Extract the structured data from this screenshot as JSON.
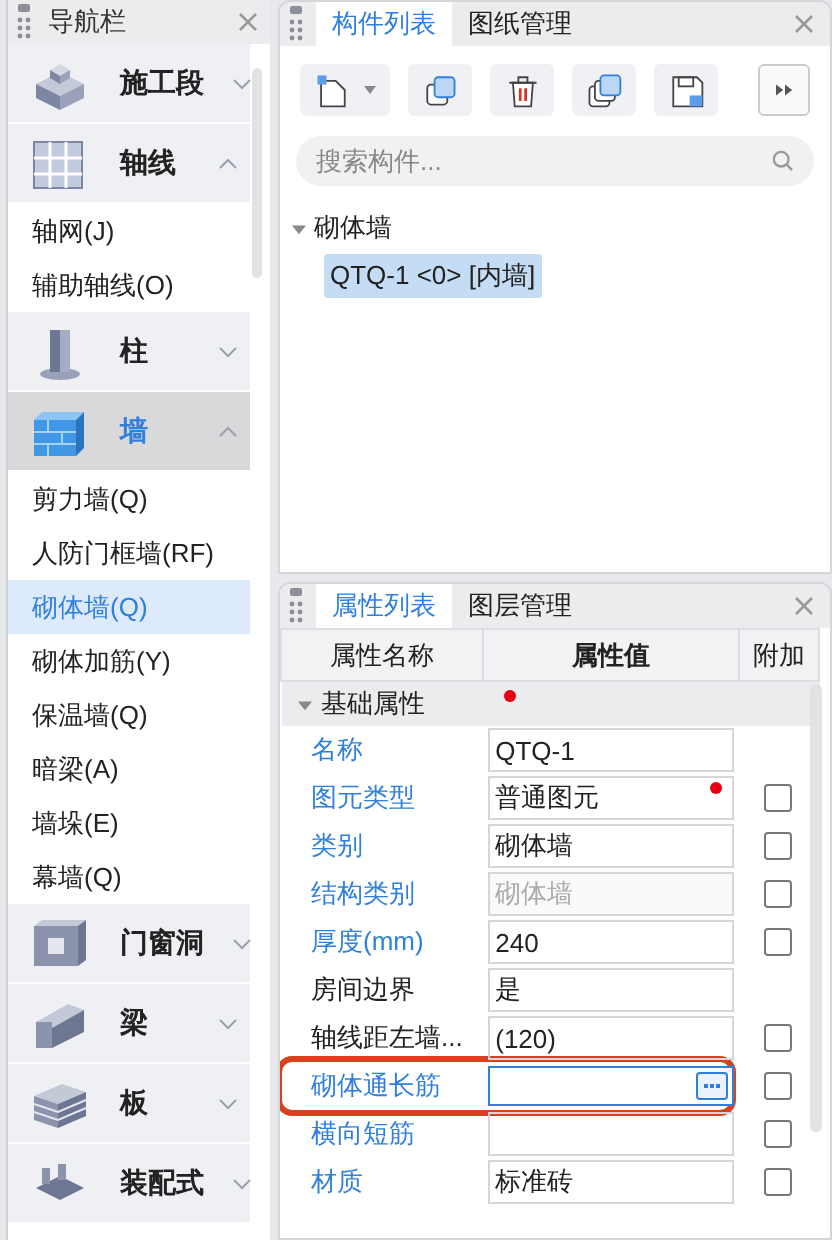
{
  "nav": {
    "title": "导航栏",
    "groups": [
      {
        "label": "施工段",
        "kind": "block",
        "expanded": false,
        "selected": false
      },
      {
        "label": "轴线",
        "kind": "grid",
        "expanded": true,
        "selected": false,
        "items": [
          {
            "label": "轴网(J)",
            "selected": false
          },
          {
            "label": "辅助轴线(O)",
            "selected": false
          }
        ]
      },
      {
        "label": "柱",
        "kind": "column",
        "expanded": false,
        "selected": false
      },
      {
        "label": "墙",
        "kind": "wall",
        "expanded": true,
        "selected": true,
        "items": [
          {
            "label": "剪力墙(Q)",
            "selected": false
          },
          {
            "label": "人防门框墙(RF)",
            "selected": false
          },
          {
            "label": "砌体墙(Q)",
            "selected": true
          },
          {
            "label": "砌体加筋(Y)",
            "selected": false
          },
          {
            "label": "保温墙(Q)",
            "selected": false
          },
          {
            "label": "暗梁(A)",
            "selected": false
          },
          {
            "label": "墙垛(E)",
            "selected": false
          },
          {
            "label": "幕墙(Q)",
            "selected": false
          }
        ]
      },
      {
        "label": "门窗洞",
        "kind": "opening",
        "expanded": false,
        "selected": false
      },
      {
        "label": "梁",
        "kind": "beam",
        "expanded": false,
        "selected": false
      },
      {
        "label": "板",
        "kind": "slab",
        "expanded": false,
        "selected": false
      },
      {
        "label": "装配式",
        "kind": "prefab",
        "expanded": false,
        "selected": false
      }
    ]
  },
  "component_panel": {
    "tabs": [
      {
        "label": "构件列表",
        "selected": true
      },
      {
        "label": "图纸管理",
        "selected": false
      }
    ],
    "toolbar": [
      {
        "kind": "new"
      },
      {
        "kind": "copy"
      },
      {
        "kind": "delete"
      },
      {
        "kind": "layer-copy"
      },
      {
        "kind": "save"
      }
    ],
    "search": {
      "placeholder": "搜索构件..."
    },
    "tree": [
      {
        "label": "砌体墙",
        "expanded": true,
        "children": [
          {
            "label": "QTQ-1 <0> [内墙]",
            "selected": true
          }
        ]
      }
    ]
  },
  "property_panel": {
    "tabs": [
      {
        "label": "属性列表",
        "selected": true
      },
      {
        "label": "图层管理",
        "selected": false
      }
    ],
    "columns": [
      "属性名称",
      "属性值",
      "附加"
    ],
    "section": {
      "label": "基础属性",
      "expanded": true,
      "marked": true
    },
    "rows": [
      {
        "name": "名称",
        "value": "QTQ-1",
        "public": true,
        "kind": "plain",
        "disabled": false,
        "marked": false,
        "editing": false,
        "annotated": false
      },
      {
        "name": "图元类型",
        "value": "普通图元",
        "public": true,
        "kind": "checkbox",
        "checked": false,
        "disabled": false,
        "marked": true,
        "editing": false,
        "annotated": false
      },
      {
        "name": "类别",
        "value": "砌体墙",
        "public": true,
        "kind": "checkbox",
        "checked": false,
        "disabled": false,
        "marked": false,
        "editing": false,
        "annotated": false
      },
      {
        "name": "结构类别",
        "value": "砌体墙",
        "public": true,
        "kind": "checkbox",
        "checked": false,
        "disabled": true,
        "marked": false,
        "editing": false,
        "annotated": false
      },
      {
        "name": "厚度(mm)",
        "value": "240",
        "public": true,
        "kind": "checkbox",
        "checked": false,
        "disabled": false,
        "marked": false,
        "editing": false,
        "annotated": false
      },
      {
        "name": "房间边界",
        "value": "是",
        "public": false,
        "kind": "plain",
        "disabled": false,
        "marked": false,
        "editing": false,
        "annotated": false
      },
      {
        "name": "轴线距左墙...",
        "value": "(120)",
        "public": false,
        "kind": "checkbox",
        "checked": false,
        "disabled": false,
        "marked": false,
        "editing": false,
        "annotated": false
      },
      {
        "name": "砌体通长筋",
        "public": true,
        "kind": "checkbox",
        "checked": false,
        "disabled": false,
        "marked": false,
        "editing": true,
        "annotated": true
      },
      {
        "name": "横向短筋",
        "public": true,
        "kind": "checkbox",
        "checked": false,
        "disabled": false,
        "marked": false,
        "editing": false,
        "annotated": false
      },
      {
        "name": "材质",
        "value": "标准砖",
        "public": true,
        "kind": "checkbox",
        "checked": false,
        "disabled": false,
        "marked": false,
        "editing": false,
        "annotated": false
      }
    ]
  }
}
